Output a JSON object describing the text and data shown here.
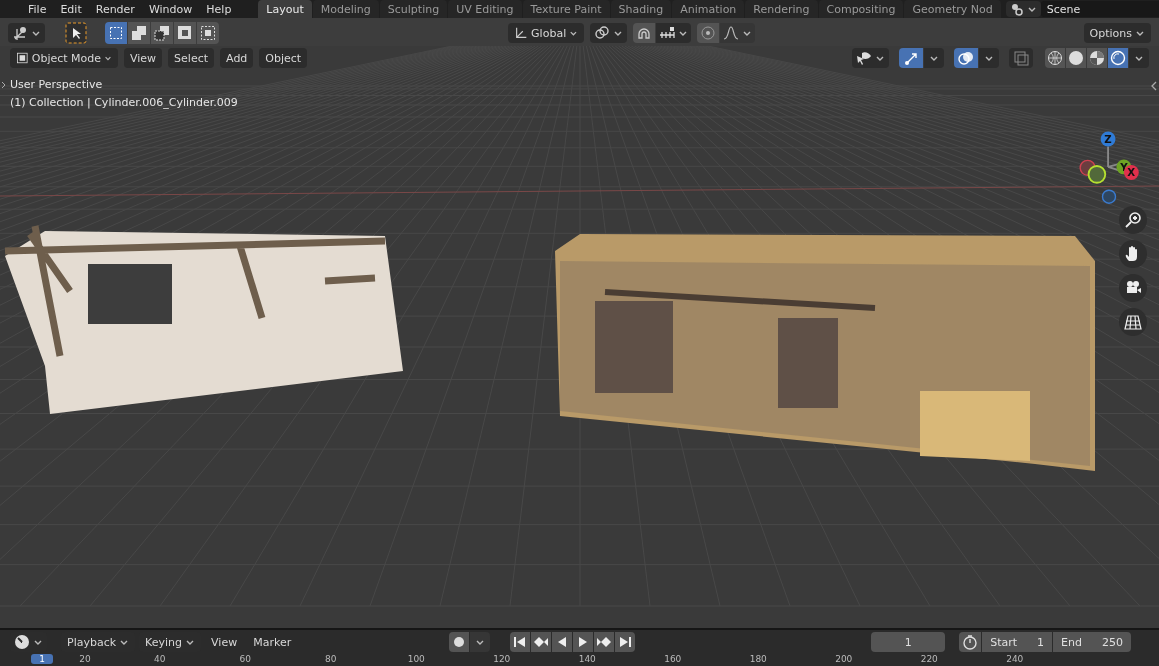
{
  "menu": [
    "File",
    "Edit",
    "Render",
    "Window",
    "Help"
  ],
  "workspaces": [
    {
      "label": "Layout",
      "selected": true
    },
    {
      "label": "Modeling",
      "selected": false
    },
    {
      "label": "Sculpting",
      "selected": false
    },
    {
      "label": "UV Editing",
      "selected": false
    },
    {
      "label": "Texture Paint",
      "selected": false
    },
    {
      "label": "Shading",
      "selected": false
    },
    {
      "label": "Animation",
      "selected": false
    },
    {
      "label": "Rendering",
      "selected": false
    },
    {
      "label": "Compositing",
      "selected": false
    },
    {
      "label": "Geometry Nod",
      "selected": false
    }
  ],
  "scene": {
    "name": "Scene"
  },
  "tool_header": {
    "select_modes": [
      {
        "kind": "set",
        "selected": true
      },
      {
        "kind": "extend",
        "selected": false
      },
      {
        "kind": "subtract",
        "selected": false
      },
      {
        "kind": "difference",
        "selected": false
      },
      {
        "kind": "intersect",
        "selected": false
      }
    ],
    "orientation": "Global",
    "options": "Options"
  },
  "viewport_header": {
    "mode": "Object Mode",
    "menus": [
      "View",
      "Select",
      "Add",
      "Object"
    ],
    "toggles": [
      {
        "kind": "gizmo",
        "on": true
      },
      {
        "kind": "overlay",
        "on": true
      },
      {
        "kind": "xray",
        "on": false
      }
    ],
    "shading_modes": [
      {
        "kind": "wireframe",
        "selected": false
      },
      {
        "kind": "solid",
        "selected": false
      },
      {
        "kind": "material",
        "selected": false
      },
      {
        "kind": "rendered",
        "selected": true
      }
    ]
  },
  "viewport": {
    "view_name": "User Perspective",
    "object_info": "(1) Collection | Cylinder.006_Cylinder.009",
    "axes": [
      {
        "label": "Z",
        "color": "#2f7bd6"
      },
      {
        "label": "Y",
        "color": "#6ea324"
      },
      {
        "label": "X",
        "color": "#e0304c"
      }
    ]
  },
  "timeline": {
    "menus": [
      {
        "label": "Playback",
        "kind": "dropdown"
      },
      {
        "label": "Keying",
        "kind": "dropdown"
      },
      {
        "label": "View",
        "kind": "menu"
      },
      {
        "label": "Marker",
        "kind": "menu"
      }
    ],
    "current_frame": "1",
    "ruler_marker": "1",
    "start_label": "Start",
    "start": "1",
    "end_label": "End",
    "end": "250",
    "ruler": [
      "20",
      "40",
      "60",
      "80",
      "100",
      "120",
      "140",
      "160",
      "180",
      "200",
      "220",
      "240"
    ]
  }
}
